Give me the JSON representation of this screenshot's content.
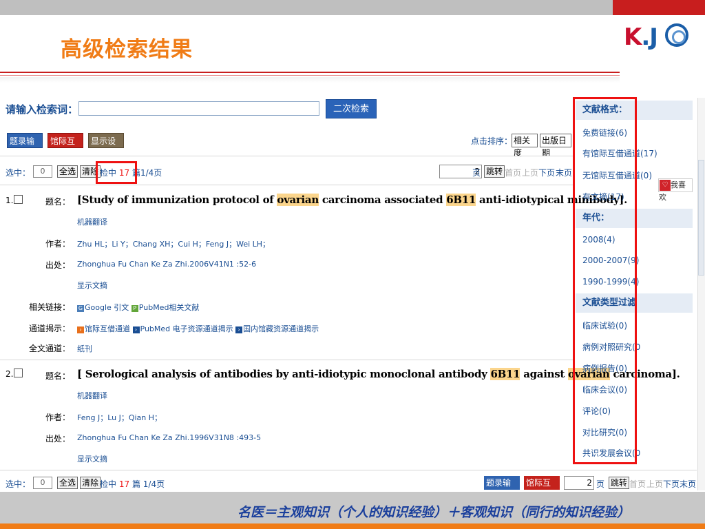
{
  "slide": {
    "title": "高级检索结果",
    "logo_text_a": "K",
    "logo_text_b": ".J",
    "motto": "名医＝主观知识（个人的知识经验）＋客观知识（同行的知识经验）"
  },
  "search": {
    "label": "请输入检索词：",
    "input_value": "",
    "secondary_button": "二次检索"
  },
  "toolbar": {
    "export": "题录输出",
    "ill": "馆际互借",
    "display": "显示设置",
    "sort_label": "点击排序：",
    "sort_relevance": "相关度",
    "sort_date": "出版日期"
  },
  "selection_bar": {
    "selected_label": "选中：",
    "selected_count": "0",
    "select_all": "全选",
    "clear": "清除",
    "hits_prefix": "检中",
    "hits_count": "17",
    "hits_suffix": "篇",
    "page_info": "1/4页",
    "page_input": "2",
    "page_unit": "页",
    "jump": "跳转",
    "first": "首页",
    "prev": "上页",
    "next": "下页",
    "last": "末页"
  },
  "records": [
    {
      "index": "1.",
      "labels": {
        "title": "题名：",
        "author": "作者：",
        "source": "出处：",
        "related": "相关链接：",
        "channel": "通道揭示：",
        "fulltext": "全文通道："
      },
      "title_parts": [
        "[Study of immunization protocol of ",
        "ovarian",
        " carcinoma associated ",
        "6B11",
        " anti-idiotypical minibody]."
      ],
      "machine_translate": "机器翻译",
      "authors": "Zhu HL；Li Y；Chang XH；Cui H；Feng J；Wei LH；",
      "source": "Zhonghua Fu Chan Ke Za Zhi.2006V41N1 :52-6",
      "show_abstract": "显示文摘",
      "related_google": "Google 引文",
      "related_pubmed": "PubMed相关文献",
      "channel_ill": "馆际互借通道",
      "channel_pubmed": "PubMed 电子资源通道揭示",
      "channel_domestic": "国内馆藏资源通道揭示",
      "fulltext": "纸刊"
    },
    {
      "index": "2.",
      "title_parts": [
        "[ Serological analysis of antibodies by anti-idiotypic monoclonal antibody ",
        "6B11",
        " against ",
        "ovarian",
        " carcinoma]."
      ],
      "machine_translate": "机器翻译",
      "authors": "Feng J；Lu J；Qian H；",
      "source": "Zhonghua Fu Chan Ke Za Zhi.1996V31N8 :493-5",
      "show_abstract": "显示文摘"
    }
  ],
  "sidebar": {
    "format_head": "文献格式：",
    "format_items": [
      "免费链接(6)",
      "有馆际互借通道(17)",
      "无馆际互借通道(0)",
      "有文摘(17)"
    ],
    "year_head": "年代：",
    "year_items": [
      "2008(4)",
      "2000-2007(9)",
      "1990-1999(4)"
    ],
    "type_head": "文献类型过滤",
    "type_items": [
      "临床试验(0)",
      "病例对照研究(0",
      "病例报告(0)",
      "临床会议(0)",
      "评论(0)",
      "对比研究(0)",
      "共识发展会议(0"
    ],
    "like": "我喜欢"
  },
  "bottom_bar": {
    "selected_label": "选中：",
    "selected_count": "0",
    "select_all": "全选",
    "clear": "清除",
    "hits_prefix": "检中",
    "hits_count": "17",
    "hits_suffix": "篇",
    "page_info": "1/4页",
    "export": "题录输出",
    "ill": "馆际互借",
    "page_input": "2",
    "page_unit": "页",
    "jump": "跳转",
    "first": "首页",
    "prev": "上页",
    "next": "下页",
    "last": "末页"
  }
}
